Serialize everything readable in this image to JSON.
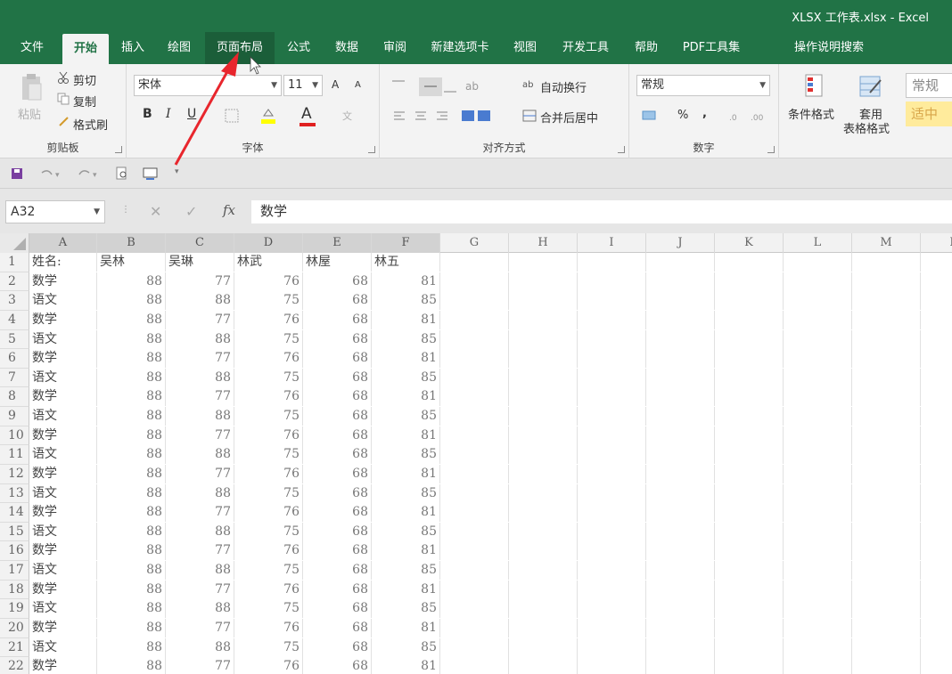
{
  "window": {
    "title": "XLSX 工作表.xlsx  -  Excel"
  },
  "tabs": [
    "文件",
    "开始",
    "插入",
    "绘图",
    "页面布局",
    "公式",
    "数据",
    "审阅",
    "新建选项卡",
    "视图",
    "开发工具",
    "帮助",
    "PDF工具集",
    "操作说明搜索"
  ],
  "active_tab": "开始",
  "ribbon": {
    "clipboard": {
      "label": "剪贴板",
      "paste": "粘贴",
      "cut": "剪切",
      "copy": "复制",
      "format_painter": "格式刷"
    },
    "font": {
      "label": "字体",
      "font_name": "宋体",
      "font_size": "11",
      "bold": "B",
      "italic": "I",
      "underline": "U",
      "grow": "A",
      "shrink": "A",
      "font_color": "A",
      "phonetic": "文"
    },
    "alignment": {
      "label": "对齐方式",
      "wrap_text": "自动换行",
      "merge_center": "合并后居中"
    },
    "number": {
      "label": "数字",
      "format": "常规",
      "percent": "%",
      "comma": ","
    },
    "styles": {
      "conditional": "条件格式",
      "table_format_1": "套用",
      "table_format_2": "表格格式",
      "style_normal": "常规",
      "style_neutral": "适中"
    }
  },
  "formula_bar": {
    "name_box": "A32",
    "fx": "fx",
    "content": "数学"
  },
  "columns": [
    "A",
    "B",
    "C",
    "D",
    "E",
    "F",
    "G",
    "H",
    "I",
    "J",
    "K",
    "L",
    "M",
    "N"
  ],
  "header_row": [
    "姓名:",
    "吴林",
    "吴琳",
    "林武",
    "林屋",
    "林五"
  ],
  "rows": [
    [
      "数学",
      "88",
      "77",
      "76",
      "68",
      "81"
    ],
    [
      "语文",
      "88",
      "88",
      "75",
      "68",
      "85"
    ],
    [
      "数学",
      "88",
      "77",
      "76",
      "68",
      "81"
    ],
    [
      "语文",
      "88",
      "88",
      "75",
      "68",
      "85"
    ],
    [
      "数学",
      "88",
      "77",
      "76",
      "68",
      "81"
    ],
    [
      "语文",
      "88",
      "88",
      "75",
      "68",
      "85"
    ],
    [
      "数学",
      "88",
      "77",
      "76",
      "68",
      "81"
    ],
    [
      "语文",
      "88",
      "88",
      "75",
      "68",
      "85"
    ],
    [
      "数学",
      "88",
      "77",
      "76",
      "68",
      "81"
    ],
    [
      "语文",
      "88",
      "88",
      "75",
      "68",
      "85"
    ],
    [
      "数学",
      "88",
      "77",
      "76",
      "68",
      "81"
    ],
    [
      "语文",
      "88",
      "88",
      "75",
      "68",
      "85"
    ],
    [
      "数学",
      "88",
      "77",
      "76",
      "68",
      "81"
    ],
    [
      "语文",
      "88",
      "88",
      "75",
      "68",
      "85"
    ],
    [
      "数学",
      "88",
      "77",
      "76",
      "68",
      "81"
    ],
    [
      "语文",
      "88",
      "88",
      "75",
      "68",
      "85"
    ],
    [
      "数学",
      "88",
      "77",
      "76",
      "68",
      "81"
    ],
    [
      "语文",
      "88",
      "88",
      "75",
      "68",
      "85"
    ],
    [
      "数学",
      "88",
      "77",
      "76",
      "68",
      "81"
    ],
    [
      "语文",
      "88",
      "88",
      "75",
      "68",
      "85"
    ],
    [
      "数学",
      "88",
      "77",
      "76",
      "68",
      "81"
    ]
  ],
  "row_numbers": [
    "1",
    "2",
    "3",
    "4",
    "5",
    "6",
    "7",
    "8",
    "9",
    "10",
    "11",
    "12",
    "13",
    "14",
    "15",
    "16",
    "17",
    "18",
    "19",
    "20",
    "21",
    "22"
  ],
  "colors": {
    "excel_green": "#217346",
    "annotation_red": "#e8262d"
  }
}
